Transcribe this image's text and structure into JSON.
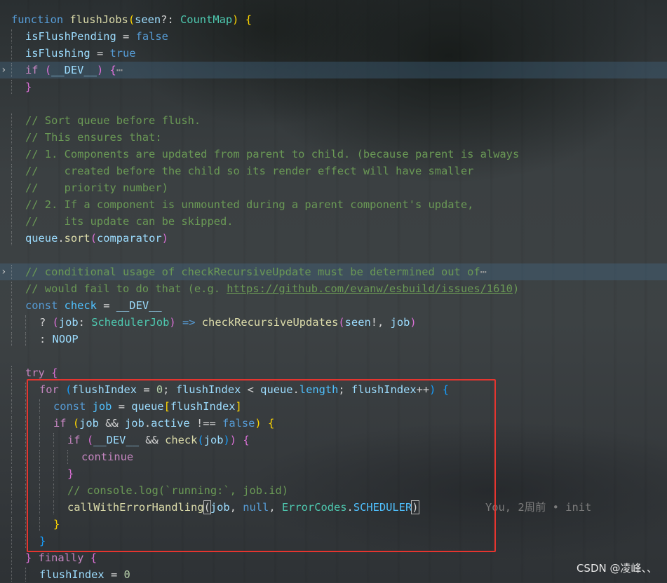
{
  "lines": [
    {
      "tokens": [
        [
          "kw",
          "function "
        ],
        [
          "fn",
          "flushJobs"
        ],
        [
          "p1",
          "("
        ],
        [
          "var",
          "seen"
        ],
        [
          "op",
          "?: "
        ],
        [
          "type",
          "CountMap"
        ],
        [
          "p1",
          ")"
        ],
        [
          "op",
          " "
        ],
        [
          "p1",
          "{"
        ]
      ]
    },
    {
      "tokens": [
        [
          "var",
          "isFlushPending"
        ],
        [
          "op",
          " = "
        ],
        [
          "kw",
          "false"
        ]
      ]
    },
    {
      "tokens": [
        [
          "var",
          "isFlushing"
        ],
        [
          "op",
          " = "
        ],
        [
          "kw",
          "true"
        ]
      ]
    },
    {
      "tokens": [
        [
          "kw2",
          "if"
        ],
        [
          "op",
          " "
        ],
        [
          "p2",
          "("
        ],
        [
          "var",
          "__DEV__"
        ],
        [
          "p2",
          ")"
        ],
        [
          "op",
          " "
        ],
        [
          "p2",
          "{"
        ],
        [
          "fold",
          "⋯"
        ]
      ]
    },
    {
      "tokens": [
        [
          "p2",
          "}"
        ]
      ]
    },
    {
      "tokens": []
    },
    {
      "tokens": [
        [
          "cm",
          "// Sort queue before flush."
        ]
      ]
    },
    {
      "tokens": [
        [
          "cm",
          "// This ensures that:"
        ]
      ]
    },
    {
      "tokens": [
        [
          "cm",
          "// 1. Components are updated from parent to child. (because parent is always"
        ]
      ]
    },
    {
      "tokens": [
        [
          "cm",
          "//    created before the child so its render effect will have smaller"
        ]
      ]
    },
    {
      "tokens": [
        [
          "cm",
          "//    priority number)"
        ]
      ]
    },
    {
      "tokens": [
        [
          "cm",
          "// 2. If a component is unmounted during a parent component's update,"
        ]
      ]
    },
    {
      "tokens": [
        [
          "cm",
          "//    its update can be skipped."
        ]
      ]
    },
    {
      "tokens": [
        [
          "var",
          "queue"
        ],
        [
          "op",
          "."
        ],
        [
          "fn",
          "sort"
        ],
        [
          "p2",
          "("
        ],
        [
          "var",
          "comparator"
        ],
        [
          "p2",
          ")"
        ]
      ]
    },
    {
      "tokens": []
    },
    {
      "tokens": [
        [
          "cm",
          "// conditional usage of checkRecursiveUpdate must be determined out of"
        ],
        [
          "fold",
          "⋯"
        ]
      ]
    },
    {
      "tokens": [
        [
          "cm",
          "// would fail to do that (e.g. "
        ],
        [
          "link",
          "https://github.com/evanw/esbuild/issues/1610"
        ],
        [
          "cm",
          ")"
        ]
      ]
    },
    {
      "tokens": [
        [
          "kw",
          "const "
        ],
        [
          "const",
          "check"
        ],
        [
          "op",
          " = "
        ],
        [
          "var",
          "__DEV__"
        ]
      ]
    },
    {
      "tokens": [
        [
          "op",
          "? "
        ],
        [
          "p2",
          "("
        ],
        [
          "var",
          "job"
        ],
        [
          "op",
          ": "
        ],
        [
          "type",
          "SchedulerJob"
        ],
        [
          "p2",
          ")"
        ],
        [
          "op",
          " "
        ],
        [
          "kw",
          "=>"
        ],
        [
          "op",
          " "
        ],
        [
          "fn",
          "checkRecursiveUpdates"
        ],
        [
          "p2",
          "("
        ],
        [
          "var",
          "seen"
        ],
        [
          "op",
          "!, "
        ],
        [
          "var",
          "job"
        ],
        [
          "p2",
          ")"
        ]
      ]
    },
    {
      "tokens": [
        [
          "op",
          ": "
        ],
        [
          "var",
          "NOOP"
        ]
      ]
    },
    {
      "tokens": []
    },
    {
      "tokens": [
        [
          "kw2",
          "try"
        ],
        [
          "op",
          " "
        ],
        [
          "p2",
          "{"
        ]
      ]
    },
    {
      "tokens": [
        [
          "kw2",
          "for"
        ],
        [
          "op",
          " "
        ],
        [
          "p3",
          "("
        ],
        [
          "var",
          "flushIndex"
        ],
        [
          "op",
          " = "
        ],
        [
          "num",
          "0"
        ],
        [
          "op",
          "; "
        ],
        [
          "var",
          "flushIndex"
        ],
        [
          "op",
          " < "
        ],
        [
          "var",
          "queue"
        ],
        [
          "op",
          "."
        ],
        [
          "const",
          "length"
        ],
        [
          "op",
          "; "
        ],
        [
          "var",
          "flushIndex"
        ],
        [
          "op",
          "++"
        ],
        [
          "p3",
          ")"
        ],
        [
          "op",
          " "
        ],
        [
          "p3",
          "{"
        ]
      ]
    },
    {
      "tokens": [
        [
          "kw",
          "const "
        ],
        [
          "const",
          "job"
        ],
        [
          "op",
          " = "
        ],
        [
          "var",
          "queue"
        ],
        [
          "p1",
          "["
        ],
        [
          "var",
          "flushIndex"
        ],
        [
          "p1",
          "]"
        ]
      ]
    },
    {
      "tokens": [
        [
          "kw2",
          "if"
        ],
        [
          "op",
          " "
        ],
        [
          "p1",
          "("
        ],
        [
          "var",
          "job"
        ],
        [
          "op",
          " && "
        ],
        [
          "var",
          "job"
        ],
        [
          "op",
          "."
        ],
        [
          "var",
          "active"
        ],
        [
          "op",
          " !== "
        ],
        [
          "kw",
          "false"
        ],
        [
          "p1",
          ")"
        ],
        [
          "op",
          " "
        ],
        [
          "p1",
          "{"
        ]
      ]
    },
    {
      "tokens": [
        [
          "kw2",
          "if"
        ],
        [
          "op",
          " "
        ],
        [
          "p2",
          "("
        ],
        [
          "var",
          "__DEV__"
        ],
        [
          "op",
          " && "
        ],
        [
          "fn",
          "check"
        ],
        [
          "p3",
          "("
        ],
        [
          "var",
          "job"
        ],
        [
          "p3",
          ")"
        ],
        [
          "p2",
          ")"
        ],
        [
          "op",
          " "
        ],
        [
          "p2",
          "{"
        ]
      ]
    },
    {
      "tokens": [
        [
          "kw2",
          "continue"
        ]
      ]
    },
    {
      "tokens": [
        [
          "p2",
          "}"
        ]
      ]
    },
    {
      "tokens": [
        [
          "cm",
          "// console.log(`running:`, job.id)"
        ]
      ]
    },
    {
      "tokens": [
        [
          "fn",
          "callWithErrorHandling"
        ],
        [
          "box",
          "("
        ],
        [
          "var",
          "job"
        ],
        [
          "op",
          ", "
        ],
        [
          "kw",
          "null"
        ],
        [
          "op",
          ", "
        ],
        [
          "type",
          "ErrorCodes"
        ],
        [
          "op",
          "."
        ],
        [
          "const",
          "SCHEDULER"
        ],
        [
          "box",
          ")"
        ]
      ]
    },
    {
      "tokens": [
        [
          "p1",
          "}"
        ]
      ]
    },
    {
      "tokens": [
        [
          "p3",
          "}"
        ]
      ]
    },
    {
      "tokens": [
        [
          "p2",
          "}"
        ],
        [
          "op",
          " "
        ],
        [
          "kw2",
          "finally"
        ],
        [
          "op",
          " "
        ],
        [
          "p2",
          "{"
        ]
      ]
    },
    {
      "tokens": [
        [
          "var",
          "flushIndex"
        ],
        [
          "op",
          " = "
        ],
        [
          "num",
          "0"
        ]
      ]
    }
  ],
  "blame": "You, 2周前 • init",
  "watermark": "CSDN @凌峰、、"
}
